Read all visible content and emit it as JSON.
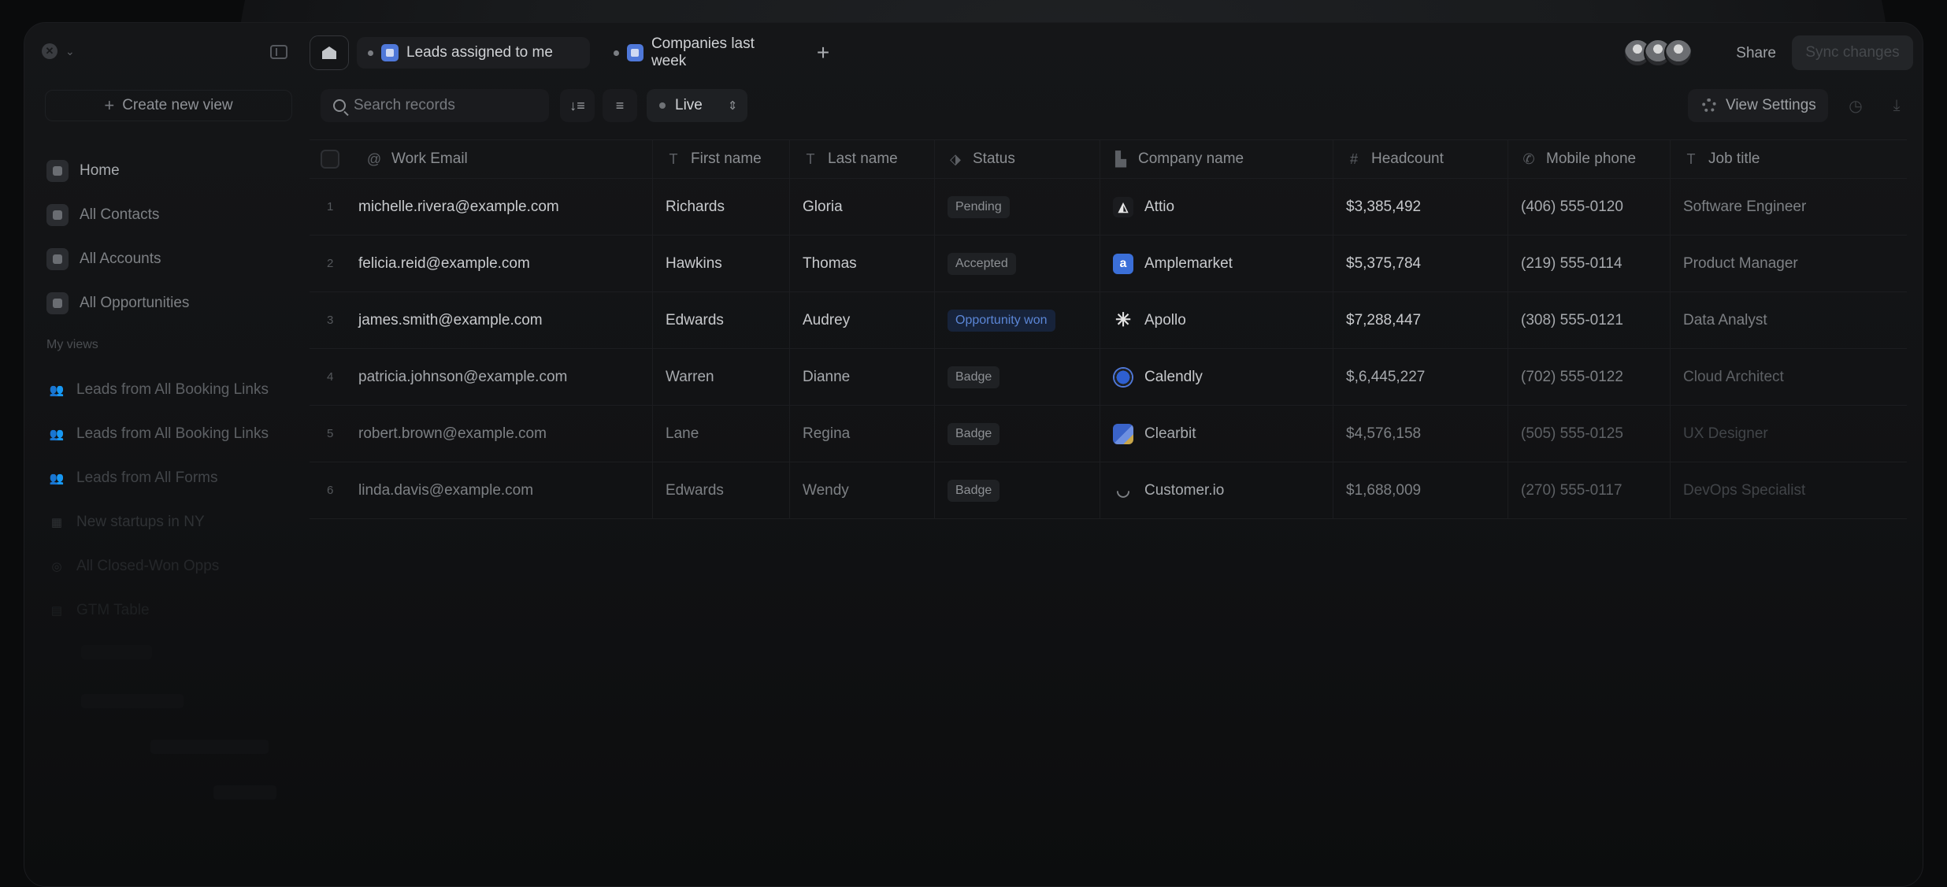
{
  "sidebar": {
    "create_label": "Create new view",
    "nav": [
      {
        "label": "Home"
      },
      {
        "label": "All Contacts"
      },
      {
        "label": "All Accounts"
      },
      {
        "label": "All Opportunities"
      }
    ],
    "my_views_label": "My views",
    "views": [
      {
        "label": "Leads from All Booking Links"
      },
      {
        "label": "Leads from All Booking Links"
      },
      {
        "label": "Leads from All Forms"
      },
      {
        "label": "New startups in NY"
      },
      {
        "label": "All Closed-Won Opps"
      },
      {
        "label": "GTM Table"
      }
    ]
  },
  "tabs": [
    {
      "label": "Leads assigned to me"
    },
    {
      "label": "Companies last week"
    }
  ],
  "header": {
    "share_label": "Share",
    "sync_label": "Sync changes"
  },
  "toolbar": {
    "search_placeholder": "Search records",
    "live_label": "Live",
    "view_settings_label": "View Settings"
  },
  "columns": [
    "Work Email",
    "First name",
    "Last name",
    "Status",
    "Company name",
    "Headcount",
    "Mobile phone",
    "Job title"
  ],
  "rows": [
    {
      "n": "1",
      "email": "michelle.rivera@example.com",
      "first": "Richards",
      "last": "Gloria",
      "status": "Pending",
      "company": "Attio",
      "headcount": "$3,385,492",
      "phone": "(406) 555-0120",
      "job": "Software Engineer"
    },
    {
      "n": "2",
      "email": "felicia.reid@example.com",
      "first": "Hawkins",
      "last": "Thomas",
      "status": "Accepted",
      "company": "Amplemarket",
      "headcount": "$5,375,784",
      "phone": "(219) 555-0114",
      "job": "Product Manager"
    },
    {
      "n": "3",
      "email": "james.smith@example.com",
      "first": "Edwards",
      "last": "Audrey",
      "status": "Opportunity won",
      "company": "Apollo",
      "headcount": "$7,288,447",
      "phone": "(308) 555-0121",
      "job": "Data Analyst"
    },
    {
      "n": "4",
      "email": "patricia.johnson@example.com",
      "first": "Warren",
      "last": "Dianne",
      "status": "Badge",
      "company": "Calendly",
      "headcount": "$,6,445,227",
      "phone": "(702) 555-0122",
      "job": "Cloud Architect"
    },
    {
      "n": "5",
      "email": "robert.brown@example.com",
      "first": "Lane",
      "last": "Regina",
      "status": "Badge",
      "company": "Clearbit",
      "headcount": "$4,576,158",
      "phone": "(505) 555-0125",
      "job": "UX Designer"
    },
    {
      "n": "6",
      "email": "linda.davis@example.com",
      "first": "Edwards",
      "last": "Wendy",
      "status": "Badge",
      "company": "Customer.io",
      "headcount": "$1,688,009",
      "phone": "(270) 555-0117",
      "job": "DevOps Specialist"
    }
  ],
  "colors": {
    "accent_blue": "#4f78d9",
    "won_badge_text": "#5b86d6"
  }
}
